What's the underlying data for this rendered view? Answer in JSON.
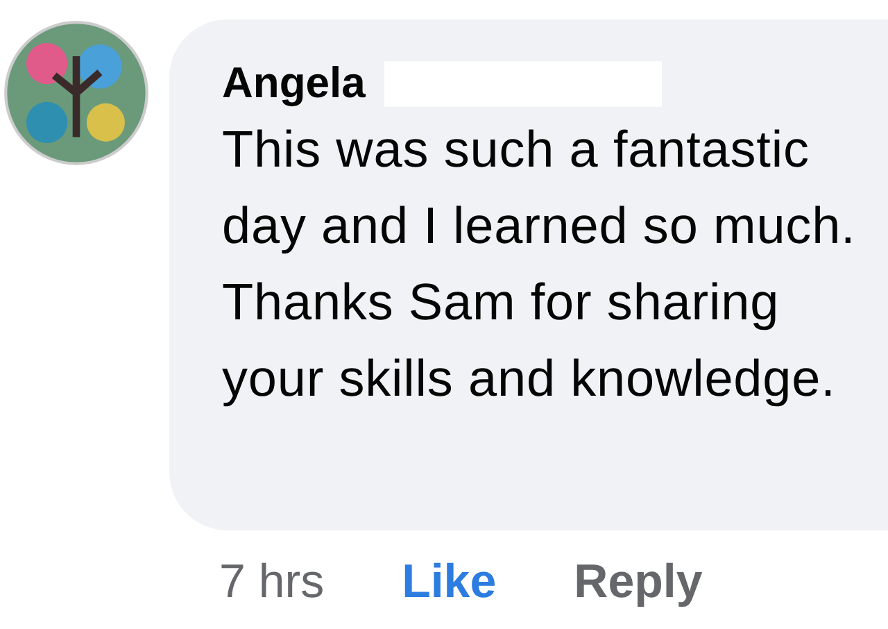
{
  "comment": {
    "author": "Angela",
    "text": "This was such a fantastic day and I learned so much. Thanks Sam for sharing your skills and knowledge.",
    "author_surname_redacted": true
  },
  "actions": [
    {
      "kind": "time",
      "label": "7 hrs"
    },
    {
      "kind": "like",
      "label": "Like",
      "liked": true
    },
    {
      "kind": "reply",
      "label": "Reply"
    }
  ]
}
